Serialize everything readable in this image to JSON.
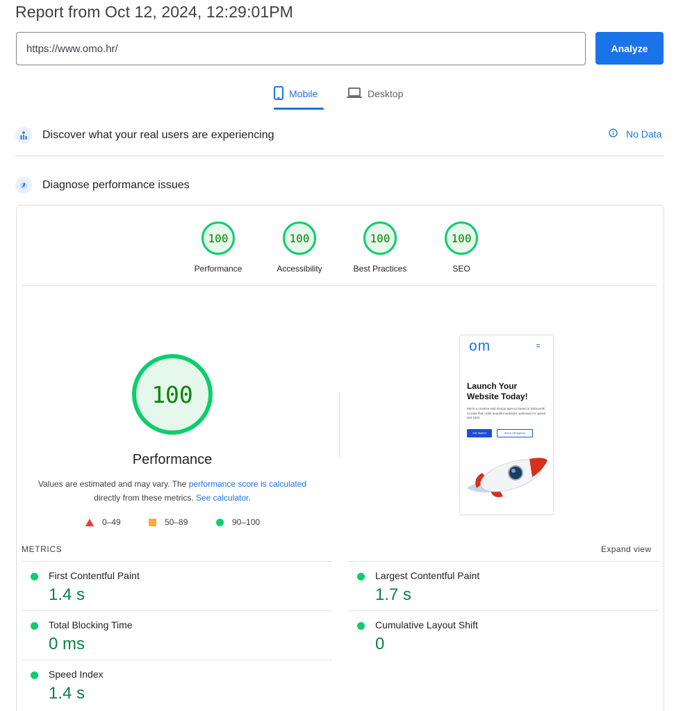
{
  "report": {
    "title": "Report from Oct 12, 2024, 12:29:01PM"
  },
  "search": {
    "url_value": "https://www.omo.hr/",
    "analyze_label": "Analyze"
  },
  "tabs": [
    {
      "label": "Mobile",
      "icon": "smartphone-icon",
      "active": true
    },
    {
      "label": "Desktop",
      "icon": "laptop-icon",
      "active": false
    }
  ],
  "crux": {
    "title": "Discover what your real users are experiencing",
    "no_data_label": "No Data",
    "icon": "people-chart-icon"
  },
  "diagnose": {
    "title": "Diagnose performance issues",
    "icon": "lighthouse-icon"
  },
  "categories": [
    {
      "label": "Performance",
      "score": "100"
    },
    {
      "label": "Accessibility",
      "score": "100"
    },
    {
      "label": "Best Practices",
      "score": "100"
    },
    {
      "label": "SEO",
      "score": "100"
    }
  ],
  "performance": {
    "score": "100",
    "label": "Performance",
    "note_prefix": "Values are estimated and may vary. The",
    "note_link": "performance score is calculated",
    "note_mid": "directly from these metrics.",
    "note_link2": "See calculator."
  },
  "legend": [
    {
      "range": "0–49",
      "shape": "triangle",
      "color": "#ff3333"
    },
    {
      "range": "50–89",
      "shape": "square",
      "color": "#ffaa33"
    },
    {
      "range": "90–100",
      "shape": "circle",
      "color": "#0cce6b"
    }
  ],
  "screenshot": {
    "logo": "om",
    "headline": "Launch Your Website Today!",
    "subtext": "We're a creative web design agency based in Dubrovnik, Croatia that crafts beautiful websites optimised for speed and SEO.",
    "cta_primary": "Get Started",
    "cta_secondary": "About OM Agency"
  },
  "metrics": {
    "title": "METRICS",
    "expand_label": "Expand view",
    "items": [
      {
        "name": "First Contentful Paint",
        "value": "1.4 s"
      },
      {
        "name": "Largest Contentful Paint",
        "value": "1.7 s"
      },
      {
        "name": "Total Blocking Time",
        "value": "0 ms"
      },
      {
        "name": "Cumulative Layout Shift",
        "value": "0"
      },
      {
        "name": "Speed Index",
        "value": "1.4 s"
      }
    ]
  },
  "colors": {
    "accent": "#1a73e8",
    "pass": "#0cce6b",
    "pass_text": "#0b8043",
    "average": "#ffaa33",
    "fail": "#ff3333"
  }
}
